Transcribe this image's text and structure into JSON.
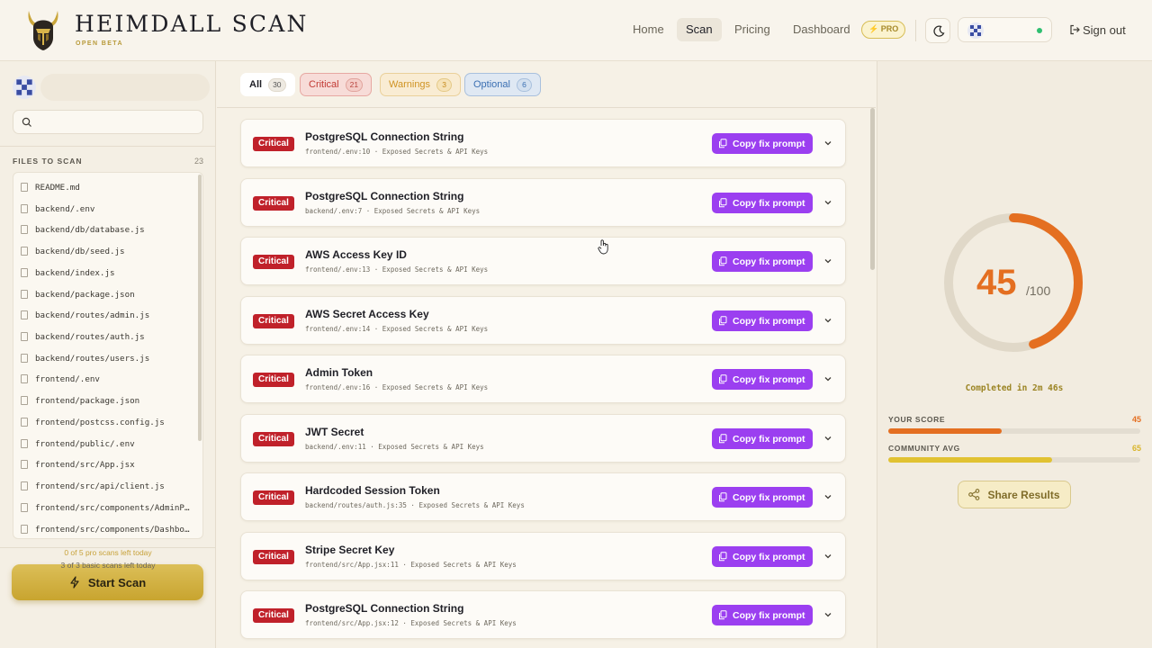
{
  "header": {
    "brand": "HEIMDALL SCAN",
    "brand_sub": "OPEN BETA",
    "nav": [
      "Home",
      "Scan",
      "Pricing",
      "Dashboard"
    ],
    "active_nav": "Scan",
    "pro_badge": "⚡ PRO",
    "sign_out": "Sign out"
  },
  "sidebar": {
    "files_title": "FILES TO SCAN",
    "files_count": "23",
    "files": [
      "README.md",
      "backend/.env",
      "backend/db/database.js",
      "backend/db/seed.js",
      "backend/index.js",
      "backend/package.json",
      "backend/routes/admin.js",
      "backend/routes/auth.js",
      "backend/routes/users.js",
      "frontend/.env",
      "frontend/package.json",
      "frontend/postcss.config.js",
      "frontend/public/.env",
      "frontend/src/App.jsx",
      "frontend/src/api/client.js",
      "frontend/src/components/AdminPanel.jsx",
      "frontend/src/components/Dashboard.jsx"
    ],
    "start_scan": "Start Scan",
    "pro_scans_left": "0 of 5 pro scans left today",
    "basic_scans_left": "3 of 3 basic scans left today"
  },
  "filters": [
    {
      "label": "All",
      "count": "30"
    },
    {
      "label": "Critical",
      "count": "21"
    },
    {
      "label": "Warnings",
      "count": "3"
    },
    {
      "label": "Optional",
      "count": "6"
    }
  ],
  "findings": [
    {
      "severity": "Critical",
      "title": "PostgreSQL Connection String",
      "location": "frontend/.env:10",
      "category": "Exposed Secrets & API Keys"
    },
    {
      "severity": "Critical",
      "title": "PostgreSQL Connection String",
      "location": "backend/.env:7",
      "category": "Exposed Secrets & API Keys"
    },
    {
      "severity": "Critical",
      "title": "AWS Access Key ID",
      "location": "frontend/.env:13",
      "category": "Exposed Secrets & API Keys"
    },
    {
      "severity": "Critical",
      "title": "AWS Secret Access Key",
      "location": "frontend/.env:14",
      "category": "Exposed Secrets & API Keys"
    },
    {
      "severity": "Critical",
      "title": "Admin Token",
      "location": "frontend/.env:16",
      "category": "Exposed Secrets & API Keys"
    },
    {
      "severity": "Critical",
      "title": "JWT Secret",
      "location": "backend/.env:11",
      "category": "Exposed Secrets & API Keys"
    },
    {
      "severity": "Critical",
      "title": "Hardcoded Session Token",
      "location": "backend/routes/auth.js:35",
      "category": "Exposed Secrets & API Keys"
    },
    {
      "severity": "Critical",
      "title": "Stripe Secret Key",
      "location": "frontend/src/App.jsx:11",
      "category": "Exposed Secrets & API Keys"
    },
    {
      "severity": "Critical",
      "title": "PostgreSQL Connection String",
      "location": "frontend/src/App.jsx:12",
      "category": "Exposed Secrets & API Keys"
    }
  ],
  "copy_fix_label": "Copy fix prompt",
  "score": {
    "value": "45",
    "max": "/100",
    "fraction": 0.45,
    "completed": "Completed in 2m 46s",
    "your_score_label": "YOUR SCORE",
    "your_score": "45",
    "community_label": "COMMUNITY AVG",
    "community": "65",
    "share": "Share Results"
  },
  "colors": {
    "accent": "#9b3ff0",
    "critical": "#c0212a",
    "score": "#e46f21",
    "gold": "#c8a42f"
  }
}
